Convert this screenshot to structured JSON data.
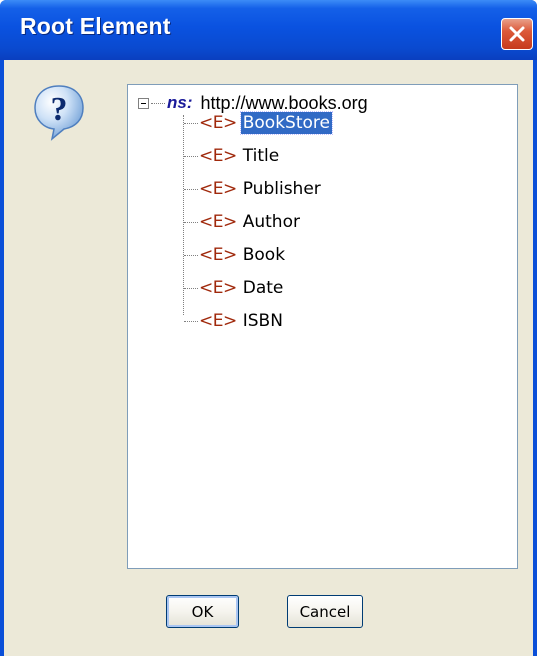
{
  "dialog": {
    "title": "Root Element",
    "close_icon": "close-icon"
  },
  "icon": {
    "name": "question-icon"
  },
  "tree": {
    "namespace": {
      "prefix": "ns:",
      "uri": "http://www.books.org",
      "expanded": true
    },
    "element_icon": "<E>",
    "items": [
      {
        "label": "BookStore",
        "selected": true
      },
      {
        "label": "Title",
        "selected": false
      },
      {
        "label": "Publisher",
        "selected": false
      },
      {
        "label": "Author",
        "selected": false
      },
      {
        "label": "Book",
        "selected": false
      },
      {
        "label": "Date",
        "selected": false
      },
      {
        "label": "ISBN",
        "selected": false
      }
    ]
  },
  "buttons": {
    "ok_label": "OK",
    "cancel_label": "Cancel"
  },
  "colors": {
    "titlebar": "#0a52e0",
    "selection": "#316ac5",
    "element_icon": "#a0290c",
    "ns_prefix": "#1a1a9a"
  }
}
